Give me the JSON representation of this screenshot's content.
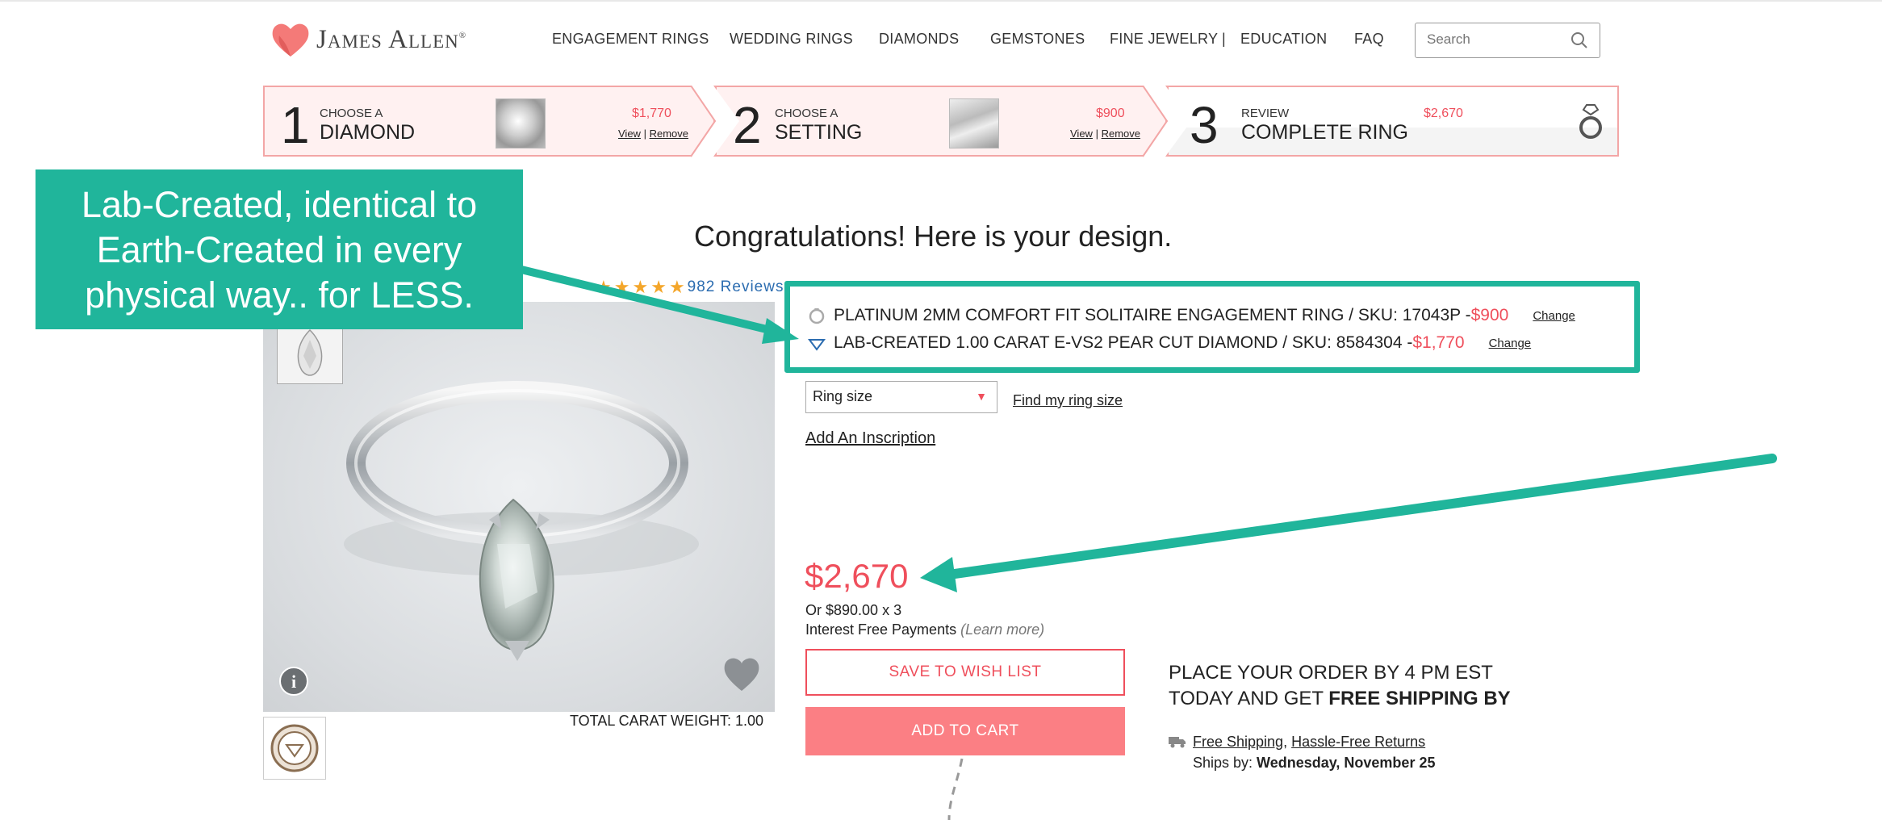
{
  "header": {
    "logo_text": "James Allen",
    "logo_reg": "®",
    "nav": [
      {
        "label": "ENGAGEMENT RINGS"
      },
      {
        "label": "WEDDING RINGS"
      },
      {
        "label": "DIAMONDS"
      },
      {
        "label": "GEMSTONES"
      },
      {
        "label": "FINE JEWELRY"
      },
      {
        "label": "EDUCATION"
      },
      {
        "label": "FAQ"
      }
    ],
    "nav_divider": "|",
    "search_placeholder": "Search"
  },
  "steps": [
    {
      "num": "1",
      "small": "CHOOSE A",
      "big": "DIAMOND",
      "price": "$1,770",
      "view": "View",
      "sep": "|",
      "remove": "Remove"
    },
    {
      "num": "2",
      "small": "CHOOSE A",
      "big": "SETTING",
      "price": "$900",
      "view": "View",
      "sep": "|",
      "remove": "Remove"
    },
    {
      "num": "3",
      "small": "REVIEW",
      "big": "COMPLETE RING",
      "price": "$2,670"
    }
  ],
  "callout": {
    "text": "Lab-Created, identical to Earth-Created in every physical way.. for LESS."
  },
  "congrats": "Congratulations! Here is your design.",
  "reviews": {
    "count_label": "982 Reviews",
    "stars": 5
  },
  "selection": {
    "ring": {
      "text": "PLATINUM 2MM COMFORT FIT SOLITAIRE ENGAGEMENT RING / SKU: 17043P - ",
      "price": "$900",
      "change": "Change"
    },
    "diamond": {
      "text": "LAB-CREATED 1.00 CARAT E-VS2 PEAR CUT DIAMOND / SKU: 8584304 - ",
      "price": "$1,770",
      "change": "Change"
    }
  },
  "ring_size": {
    "label": "Ring size",
    "arrow": "▼",
    "find_link": "Find my ring size"
  },
  "inscription": "Add An Inscription",
  "price": "$2,670",
  "installment": "Or $890.00 x 3",
  "interest": {
    "text": "Interest Free Payments",
    "learn": "(Learn more)"
  },
  "buttons": {
    "wish": "SAVE TO WISH LIST",
    "cart": "ADD TO CART"
  },
  "total_carat": "TOTAL CARAT WEIGHT: 1.00",
  "order": {
    "line1": "PLACE YOUR ORDER BY 4 PM EST",
    "line2_prefix": "TODAY AND GET ",
    "line2_bold": "FREE SHIPPING BY"
  },
  "shipping": {
    "free": "Free Shipping",
    "comma": ",",
    "returns": "Hassle-Free Returns",
    "ships_prefix": "Ships by: ",
    "ships_date": "Wednesday, November 25"
  },
  "colors": {
    "accent": "#ef4f5c",
    "callout": "#20b59b",
    "cart": "#fb7f84",
    "step_bg": "#fff1f1"
  }
}
